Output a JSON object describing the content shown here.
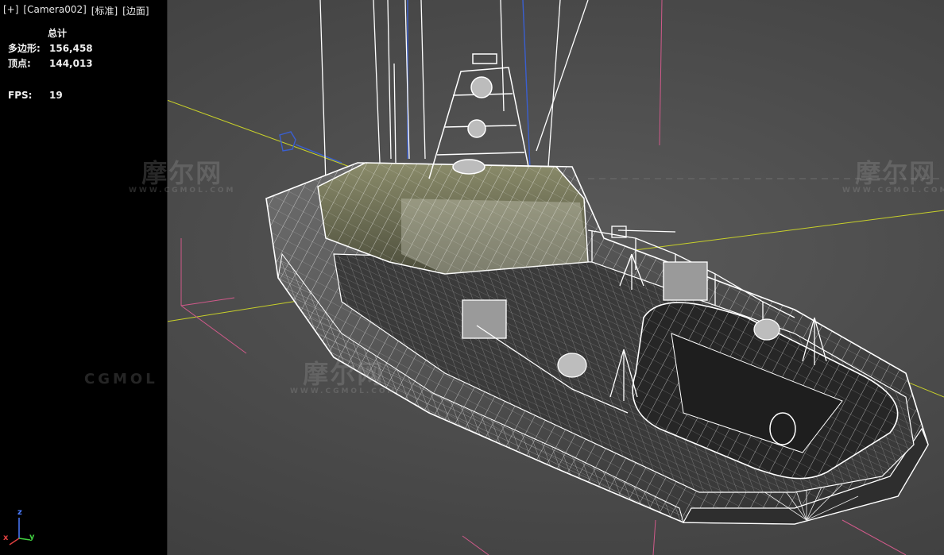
{
  "viewport": {
    "label_plus": "[+]",
    "label_camera": "[Camera002]",
    "label_shading": "[标准]",
    "label_display": "[边面]"
  },
  "stats": {
    "header": "总计",
    "polys_label": "多边形:",
    "polys_value": "156,458",
    "verts_label": "顶点:",
    "verts_value": "144,013",
    "fps_label": "FPS:",
    "fps_value": "19"
  },
  "watermark": {
    "brand": "摩尔网",
    "domain": "WWW.CGMOL.COM",
    "left_text": "CGMOL"
  },
  "gizmo": {
    "axis_z": "z",
    "axis_x": "x",
    "axis_y": "y"
  },
  "colors": {
    "grid_line": "#c8d02a",
    "bounding_pink": "#d05a8a",
    "light_blue": "#3a5fd0",
    "wire": "#ffffff"
  }
}
